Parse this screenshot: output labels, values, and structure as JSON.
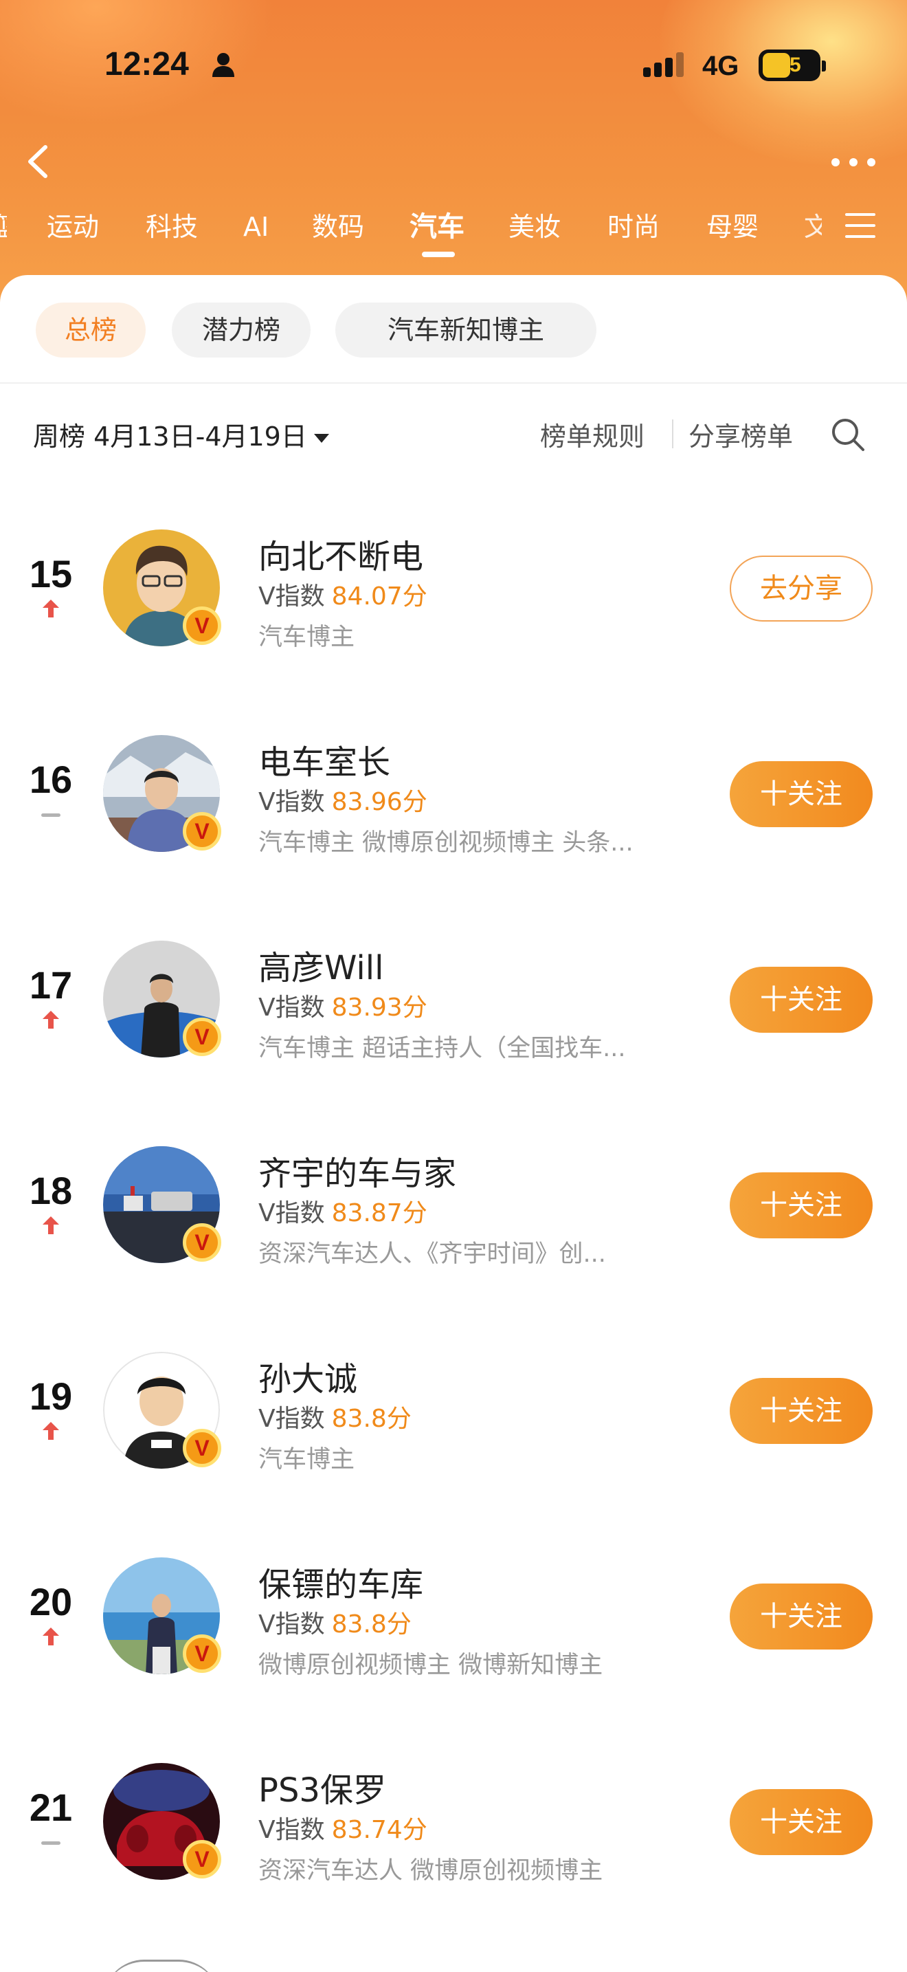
{
  "status_bar": {
    "time": "12:24",
    "network": "4G",
    "battery": "45"
  },
  "header": {
    "nav_tabs": [
      {
        "label": "运动",
        "active": false
      },
      {
        "label": "科技",
        "active": false
      },
      {
        "label": "AI",
        "active": false
      },
      {
        "label": "数码",
        "active": false
      },
      {
        "label": "汽车",
        "active": true
      },
      {
        "label": "美妆",
        "active": false
      },
      {
        "label": "时尚",
        "active": false
      },
      {
        "label": "母婴",
        "active": false
      }
    ]
  },
  "chips": [
    {
      "label": "总榜",
      "active": true
    },
    {
      "label": "潜力榜",
      "active": false
    },
    {
      "label": "汽车新知博主",
      "active": false
    }
  ],
  "toolbar": {
    "period": "周榜 4月13日-4月19日",
    "rules": "榜单规则",
    "share_list": "分享榜单"
  },
  "colors": {
    "accent": "#f08a1a",
    "header": "#f39240",
    "up": "#e8544a"
  },
  "rows": [
    {
      "rank": "15",
      "trend": "up",
      "name": "向北不断电",
      "score_label": "V指数",
      "score": "84.07分",
      "desc": "汽车博主",
      "action": "去分享"
    },
    {
      "rank": "16",
      "trend": "flat",
      "name": "电车室长",
      "score_label": "V指数",
      "score": "83.96分",
      "desc": "汽车博主 微博原创视频博主 头条...",
      "action": "十关注"
    },
    {
      "rank": "17",
      "trend": "up",
      "name": "高彦Will",
      "score_label": "V指数",
      "score": "83.93分",
      "desc": "汽车博主 超话主持人（全国找车...",
      "action": "十关注"
    },
    {
      "rank": "18",
      "trend": "up",
      "name": "齐宇的车与家",
      "score_label": "V指数",
      "score": "83.87分",
      "desc": "资深汽车达人、《齐宇时间》创...",
      "action": "十关注"
    },
    {
      "rank": "19",
      "trend": "up",
      "name": "孙大诚",
      "score_label": "V指数",
      "score": "83.8分",
      "desc": "汽车博主",
      "action": "十关注"
    },
    {
      "rank": "20",
      "trend": "up",
      "name": "保镖的车库",
      "score_label": "V指数",
      "score": "83.8分",
      "desc": "微博原创视频博主 微博新知博主",
      "action": "十关注"
    },
    {
      "rank": "21",
      "trend": "flat",
      "name": "PS3保罗",
      "score_label": "V指数",
      "score": "83.74分",
      "desc": "资深汽车达人 微博原创视频博主",
      "action": "十关注"
    }
  ]
}
